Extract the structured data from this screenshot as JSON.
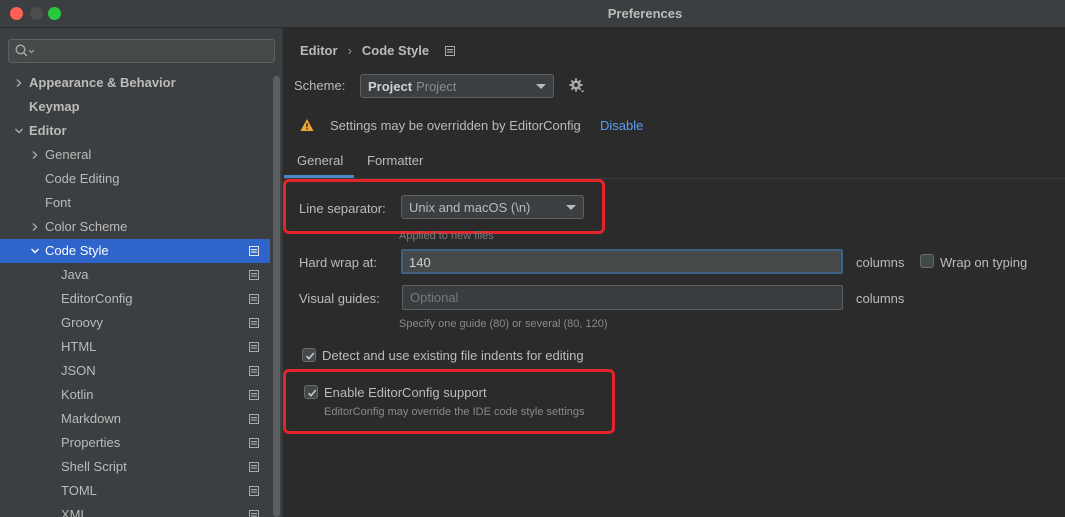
{
  "window": {
    "title": "Preferences"
  },
  "sidebar": {
    "search": {
      "placeholder": "",
      "value": ""
    },
    "items": [
      {
        "label": "Appearance & Behavior",
        "bold": true,
        "expandable": true,
        "expanded": false,
        "level": 0,
        "selected": false,
        "page_icon": false
      },
      {
        "label": "Keymap",
        "bold": true,
        "expandable": false,
        "level": 0,
        "selected": false,
        "page_icon": false
      },
      {
        "label": "Editor",
        "bold": true,
        "expandable": true,
        "expanded": true,
        "level": 0,
        "selected": false,
        "page_icon": false
      },
      {
        "label": "General",
        "bold": false,
        "expandable": true,
        "expanded": false,
        "level": 1,
        "selected": false,
        "page_icon": false
      },
      {
        "label": "Code Editing",
        "bold": false,
        "expandable": false,
        "level": 1,
        "selected": false,
        "page_icon": false
      },
      {
        "label": "Font",
        "bold": false,
        "expandable": false,
        "level": 1,
        "selected": false,
        "page_icon": false
      },
      {
        "label": "Color Scheme",
        "bold": false,
        "expandable": true,
        "expanded": false,
        "level": 1,
        "selected": false,
        "page_icon": false
      },
      {
        "label": "Code Style",
        "bold": false,
        "expandable": true,
        "expanded": true,
        "level": 1,
        "selected": true,
        "page_icon": true
      },
      {
        "label": "Java",
        "bold": false,
        "expandable": false,
        "level": 2,
        "selected": false,
        "page_icon": true
      },
      {
        "label": "EditorConfig",
        "bold": false,
        "expandable": false,
        "level": 2,
        "selected": false,
        "page_icon": true
      },
      {
        "label": "Groovy",
        "bold": false,
        "expandable": false,
        "level": 2,
        "selected": false,
        "page_icon": true
      },
      {
        "label": "HTML",
        "bold": false,
        "expandable": false,
        "level": 2,
        "selected": false,
        "page_icon": true
      },
      {
        "label": "JSON",
        "bold": false,
        "expandable": false,
        "level": 2,
        "selected": false,
        "page_icon": true
      },
      {
        "label": "Kotlin",
        "bold": false,
        "expandable": false,
        "level": 2,
        "selected": false,
        "page_icon": true
      },
      {
        "label": "Markdown",
        "bold": false,
        "expandable": false,
        "level": 2,
        "selected": false,
        "page_icon": true
      },
      {
        "label": "Properties",
        "bold": false,
        "expandable": false,
        "level": 2,
        "selected": false,
        "page_icon": true
      },
      {
        "label": "Shell Script",
        "bold": false,
        "expandable": false,
        "level": 2,
        "selected": false,
        "page_icon": true
      },
      {
        "label": "TOML",
        "bold": false,
        "expandable": false,
        "level": 2,
        "selected": false,
        "page_icon": true
      },
      {
        "label": "XML",
        "bold": false,
        "expandable": false,
        "level": 2,
        "selected": false,
        "page_icon": true
      }
    ]
  },
  "main": {
    "breadcrumb": [
      "Editor",
      "Code Style"
    ],
    "scheme": {
      "label": "Scheme:",
      "value_bold": "Project",
      "value_sub": "Project"
    },
    "warning": {
      "text": "Settings may be overridden by EditorConfig",
      "link": "Disable"
    },
    "tabs": [
      {
        "label": "General",
        "active": true
      },
      {
        "label": "Formatter",
        "active": false
      }
    ],
    "line_separator": {
      "label": "Line separator:",
      "value": "Unix and macOS (\\n)",
      "hint": "Applied to new files"
    },
    "hard_wrap": {
      "label": "Hard wrap at:",
      "value": "140",
      "unit": "columns"
    },
    "wrap_on_typing": {
      "label": "Wrap on typing",
      "checked": false
    },
    "visual_guides": {
      "label": "Visual guides:",
      "placeholder": "Optional",
      "unit": "columns",
      "hint": "Specify one guide (80) or several (80, 120)"
    },
    "detect_indents": {
      "label": "Detect and use existing file indents for editing",
      "checked": true
    },
    "editorconfig": {
      "label": "Enable EditorConfig support",
      "checked": true,
      "hint": "EditorConfig may override the IDE code style settings"
    }
  },
  "colors": {
    "accent": "#2f65ca",
    "link": "#589df6",
    "highlight": "#e3242b",
    "warning": "#f0a732"
  }
}
